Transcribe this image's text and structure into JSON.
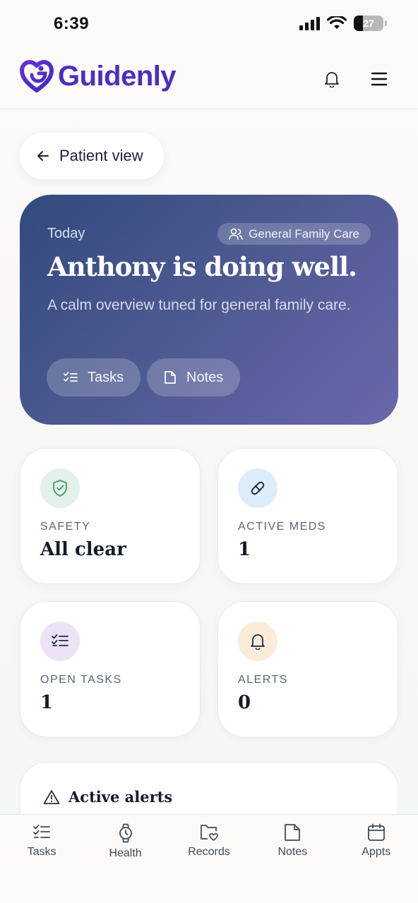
{
  "status_bar": {
    "time": "6:39",
    "battery": "27"
  },
  "header": {
    "brand": "Guidenly",
    "icons": [
      "bell-icon",
      "menu-icon"
    ]
  },
  "back": {
    "label": "Patient view",
    "icon": "arrow-left-icon"
  },
  "hero": {
    "eyebrow": "Today",
    "tag": "General Family Care",
    "title": "Anthony is doing well.",
    "subtitle": "A calm overview tuned for general family care.",
    "chips": [
      {
        "label": "Tasks",
        "icon": "checklist-icon"
      },
      {
        "label": "Notes",
        "icon": "note-icon"
      }
    ]
  },
  "stats": [
    {
      "label": "SAFETY",
      "value": "All clear",
      "icon": "shield-check-icon",
      "color": "#e3f1ea"
    },
    {
      "label": "ACTIVE MEDS",
      "value": "1",
      "icon": "pill-icon",
      "color": "#dcecf9"
    },
    {
      "label": "OPEN TASKS",
      "value": "1",
      "icon": "checklist-icon",
      "color": "#ece3f6"
    },
    {
      "label": "ALERTS",
      "value": "0",
      "icon": "bell-icon",
      "color": "#fbecda"
    }
  ],
  "alerts": {
    "title": "Active alerts",
    "icon": "warning-triangle-icon"
  },
  "nav": [
    {
      "label": "Tasks",
      "icon": "checklist-icon"
    },
    {
      "label": "Health",
      "icon": "watch-icon"
    },
    {
      "label": "Records",
      "icon": "folder-heart-icon"
    },
    {
      "label": "Notes",
      "icon": "note-icon"
    },
    {
      "label": "Appts",
      "icon": "calendar-icon"
    }
  ],
  "colors": {
    "brand": "#4a2fbf",
    "hero_start": "#324a7e",
    "hero_end": "#6a67aa"
  }
}
